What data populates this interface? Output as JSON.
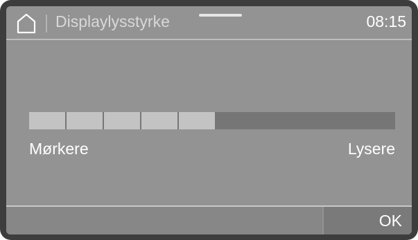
{
  "header": {
    "home_icon": "home-icon",
    "title": "Displaylysstyrke",
    "time": "08:15"
  },
  "brightness": {
    "level": 5,
    "max_level": 10,
    "min_label": "Mørkere",
    "max_label": "Lysere"
  },
  "footer": {
    "ok_label": "OK"
  },
  "colors": {
    "screen_bg": "#939393",
    "segment_active": "#c3c3c3",
    "segment_inactive": "#767676",
    "ok_button_bg": "#7a7a7a"
  }
}
